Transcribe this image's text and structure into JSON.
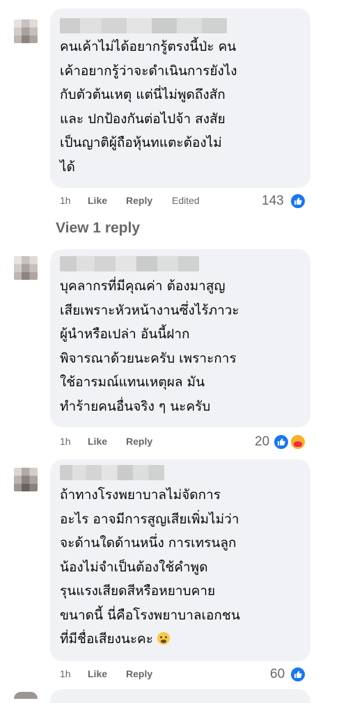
{
  "comments": [
    {
      "text": "คนเค้าไม่ได้อยากรู้ตรงนี้ป่ะ คน\nเค้าอยากรู้ว่าจะดำเนินการยังไง\nกับตัวต้นเหตุ แต่นี่ไม่พูดถึงสัก\nและ ปกป้องกันต่อไปจ้า สงสัย\nเป็นญาติผู้ถือหุ้นทแตะต้องไม่\nได้",
      "time": "1h",
      "like_label": "Like",
      "reply_label": "Reply",
      "edited_label": "Edited",
      "reaction_count": "143",
      "reactions": [
        "like-icon"
      ]
    },
    {
      "text": "บุคลากรที่มีคุณค่า ต้องมาสูญ\nเสียเพราะหัวหน้างานซึ่งไร้ภาวะ\nผู้นำหรือเปล่า อันนี้ฝาก\nพิจารณาด้วยนะครับ เพราะการ\nใช้อารมณ์แทนเหตุผล มัน\nทำร้ายคนอื่นจริง ๆ นะครับ",
      "time": "1h",
      "like_label": "Like",
      "reply_label": "Reply",
      "reaction_count": "20",
      "reactions": [
        "like-icon",
        "care-icon"
      ]
    },
    {
      "text": "ถ้าทางโรงพยาบาลไม่จัดการ\nอะไร อาจมีการสูญเสียเพิ่มไม่ว่า\nจะด้านใดด้านหนึ่ง การเทรนลูก\nน้องไม่จำเป็นต้องใช้คำพูด\nรุนแรงเสียดสีหรือหยาบคาย\nขนาดนี้ นี่คือโรงพยาบาลเอกชน\nที่มีชื่อเสียงนะคะ",
      "time": "1h",
      "like_label": "Like",
      "reply_label": "Reply",
      "reaction_count": "60",
      "reactions": [
        "like-icon"
      ]
    }
  ],
  "view_replies_label": "View 1 reply",
  "colors": {
    "bubble": "#f0f2f5",
    "meta_text": "#65676b",
    "like_blue": "#1877f2"
  }
}
